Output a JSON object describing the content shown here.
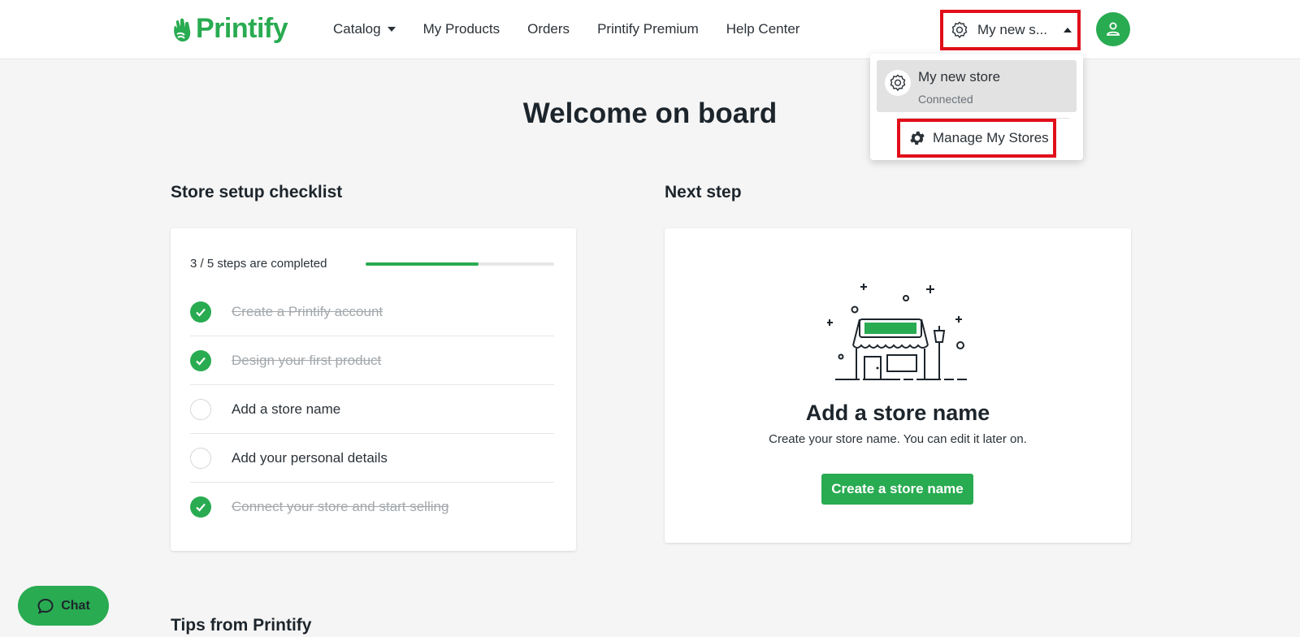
{
  "header": {
    "logo_text": "Printify",
    "nav": [
      {
        "label": "Catalog"
      },
      {
        "label": "My Products"
      },
      {
        "label": "Orders"
      },
      {
        "label": "Printify Premium"
      },
      {
        "label": "Help Center"
      }
    ],
    "store_select_label": "My new s..."
  },
  "dropdown": {
    "store_name": "My new store",
    "store_status": "Connected",
    "manage_label": "Manage My Stores"
  },
  "main": {
    "title": "Welcome on board",
    "checklist_title": "Store setup checklist",
    "next_title": "Next step",
    "progress_text": "3 / 5 steps are completed",
    "progress_fraction": 0.6,
    "steps": [
      {
        "label": "Create a Printify account",
        "done": true
      },
      {
        "label": "Design your first product",
        "done": true
      },
      {
        "label": "Add a store name",
        "done": false
      },
      {
        "label": "Add your personal details",
        "done": false
      },
      {
        "label": "Connect your store and start selling",
        "done": true
      }
    ],
    "next": {
      "heading": "Add a store name",
      "subtext": "Create your store name. You can edit it later on.",
      "button": "Create a store name"
    },
    "tips_title": "Tips from Printify"
  },
  "chat": {
    "label": "Chat"
  },
  "colors": {
    "brand": "#29ab51",
    "highlight": "#e00f1a"
  }
}
